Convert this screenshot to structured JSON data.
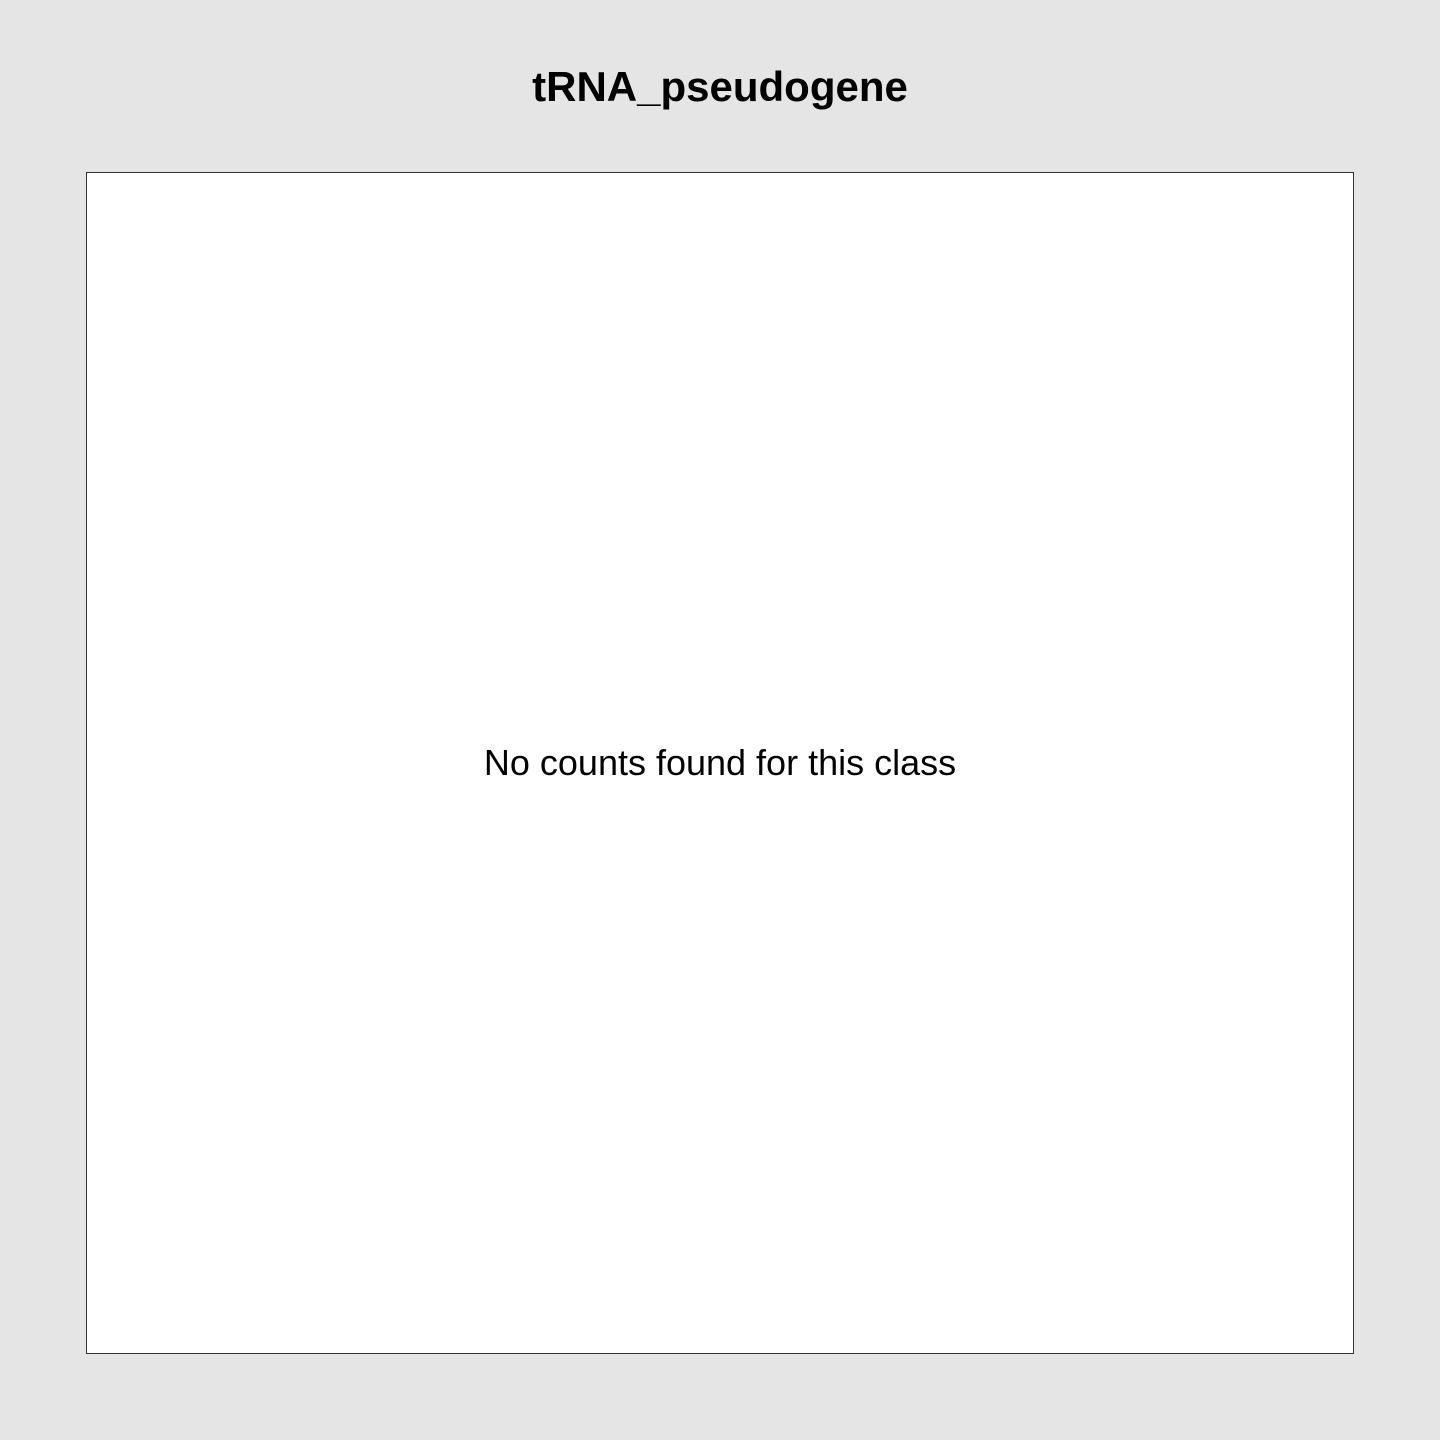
{
  "chart_data": {
    "type": "bar",
    "title": "tRNA_pseudogene",
    "message": "No counts found for this class",
    "categories": [],
    "values": [],
    "xlabel": "",
    "ylabel": "",
    "grid": false
  },
  "colors": {
    "background": "#e5e5e5",
    "panel": "#ffffff",
    "border": "#333333",
    "text": "#000000"
  }
}
